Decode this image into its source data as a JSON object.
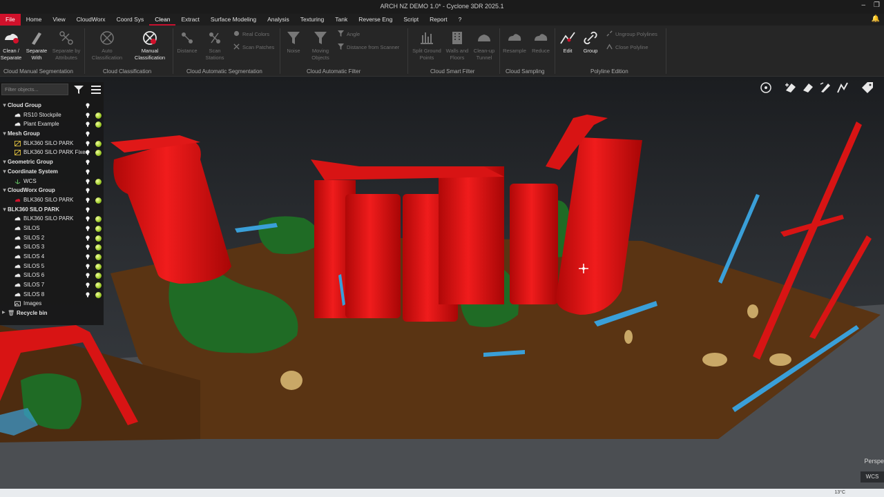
{
  "window": {
    "title": "ARCH NZ DEMO 1.0* - Cyclone 3DR 2025.1"
  },
  "menu": [
    {
      "label": "File"
    },
    {
      "label": "Home"
    },
    {
      "label": "View"
    },
    {
      "label": "CloudWorx"
    },
    {
      "label": "Coord Sys"
    },
    {
      "label": "Clean"
    },
    {
      "label": "Extract"
    },
    {
      "label": "Surface Modeling"
    },
    {
      "label": "Analysis"
    },
    {
      "label": "Texturing"
    },
    {
      "label": "Tank"
    },
    {
      "label": "Reverse Eng"
    },
    {
      "label": "Script"
    },
    {
      "label": "Report"
    },
    {
      "label": "?"
    }
  ],
  "active_tab": "Clean",
  "ribbon": {
    "buttons": {
      "clean_separate": "Clean / Separate",
      "separate_with": "Separate With",
      "separate_by_attributes": "Separate by Attributes",
      "auto_classification": "Auto Classification",
      "manual_classification": "Manual Classification",
      "distance": "Distance",
      "scan_stations": "Scan Stations",
      "real_colors": "Real Colors",
      "scan_patches": "Scan Patches",
      "noise": "Noise",
      "moving_objects": "Moving Objects",
      "angle": "Angle",
      "distance_from_scanner": "Distance from Scanner",
      "split_ground_points": "Split Ground Points",
      "walls_and_floors": "Walls and Floors",
      "clean_up_tunnel": "Clean-up Tunnel",
      "resample": "Resample",
      "reduce": "Reduce",
      "edit": "Edit",
      "group": "Group",
      "ungroup_polylines": "Ungroup Polylines",
      "close_polyline": "Close Polyline"
    },
    "groups": {
      "cloud_manual_segmentation": "Cloud Manual Segmentation",
      "cloud_classification": "Cloud Classification",
      "cloud_automatic_segmentation": "Cloud Automatic Segmentation",
      "cloud_automatic_filter": "Cloud Automatic Filter",
      "cloud_smart_filter": "Cloud Smart Filter",
      "cloud_sampling": "Cloud Sampling",
      "polyline_edition": "Polyline Edition"
    }
  },
  "panel": {
    "filter_placeholder": "Filter objects...",
    "tree": [
      {
        "type": "group",
        "label": "Cloud Group"
      },
      {
        "type": "item",
        "label": "RS10 Stockpile",
        "icon": "cloud-icon"
      },
      {
        "type": "item",
        "label": "Plant Example",
        "icon": "cloud-icon"
      },
      {
        "type": "group",
        "label": "Mesh Group"
      },
      {
        "type": "item",
        "label": "BLK360 SILO PARK",
        "icon": "mesh-icon"
      },
      {
        "type": "item",
        "label": "BLK360 SILO PARK Fixed",
        "icon": "mesh-icon"
      },
      {
        "type": "group",
        "label": "Geometric Group"
      },
      {
        "type": "group",
        "label": "Coordinate System"
      },
      {
        "type": "item",
        "label": "WCS",
        "icon": "axes-icon"
      },
      {
        "type": "group",
        "label": "CloudWorx Group"
      },
      {
        "type": "item",
        "label": "BLK360 SILO PARK",
        "icon": "cloudworx-icon"
      },
      {
        "type": "group",
        "label": "BLK360 SILO PARK"
      },
      {
        "type": "item",
        "label": "BLK360 SILO PARK",
        "icon": "cloud-icon"
      },
      {
        "type": "item",
        "label": "SILOS",
        "icon": "cloud-icon"
      },
      {
        "type": "item",
        "label": "SILOS 2",
        "icon": "cloud-icon"
      },
      {
        "type": "item",
        "label": "SILOS 3",
        "icon": "cloud-icon"
      },
      {
        "type": "item",
        "label": "SILOS 4",
        "icon": "cloud-icon"
      },
      {
        "type": "item",
        "label": "SILOS 5",
        "icon": "cloud-icon"
      },
      {
        "type": "item",
        "label": "SILOS 6",
        "icon": "cloud-icon"
      },
      {
        "type": "item",
        "label": "SILOS 7",
        "icon": "cloud-icon"
      },
      {
        "type": "item",
        "label": "SILOS 8",
        "icon": "cloud-icon"
      },
      {
        "type": "item",
        "label": "Images",
        "icon": "images-icon"
      },
      {
        "type": "group",
        "label": "Recycle bin",
        "icon": "trash-icon"
      }
    ]
  },
  "viewport": {
    "projection_label": "Perspe",
    "coord_label": "WCS"
  },
  "taskbar": {
    "temperature": "13°C"
  },
  "colors": {
    "accent": "#c8102e",
    "silo": "#e41010",
    "ground": "#5a3413",
    "vegetation": "#1f6b25",
    "structure": "#3a9fd8"
  }
}
